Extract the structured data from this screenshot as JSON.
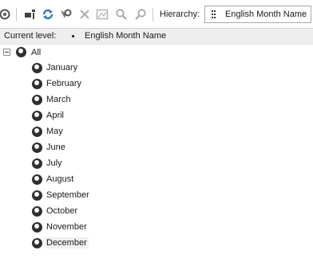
{
  "toolbar": {
    "icons": [
      "refresh-icon",
      "member-properties-icon",
      "reprocess-icon",
      "filter-members-icon",
      "delete-icon",
      "image-icon",
      "search-icon",
      "find-next-icon"
    ],
    "hierarchy_label": "Hierarchy:",
    "hierarchy_value": "English Month Name"
  },
  "level_bar": {
    "label": "Current level:",
    "value": "English Month Name"
  },
  "tree": {
    "root": "All",
    "months": [
      "January",
      "February",
      "March",
      "April",
      "May",
      "June",
      "July",
      "August",
      "September",
      "October",
      "November",
      "December"
    ],
    "selected": "December"
  },
  "colors": {
    "accent": "#3d88c6",
    "node_icon": "#2f2f2f",
    "level_bar_bg": "#eeeeee"
  }
}
